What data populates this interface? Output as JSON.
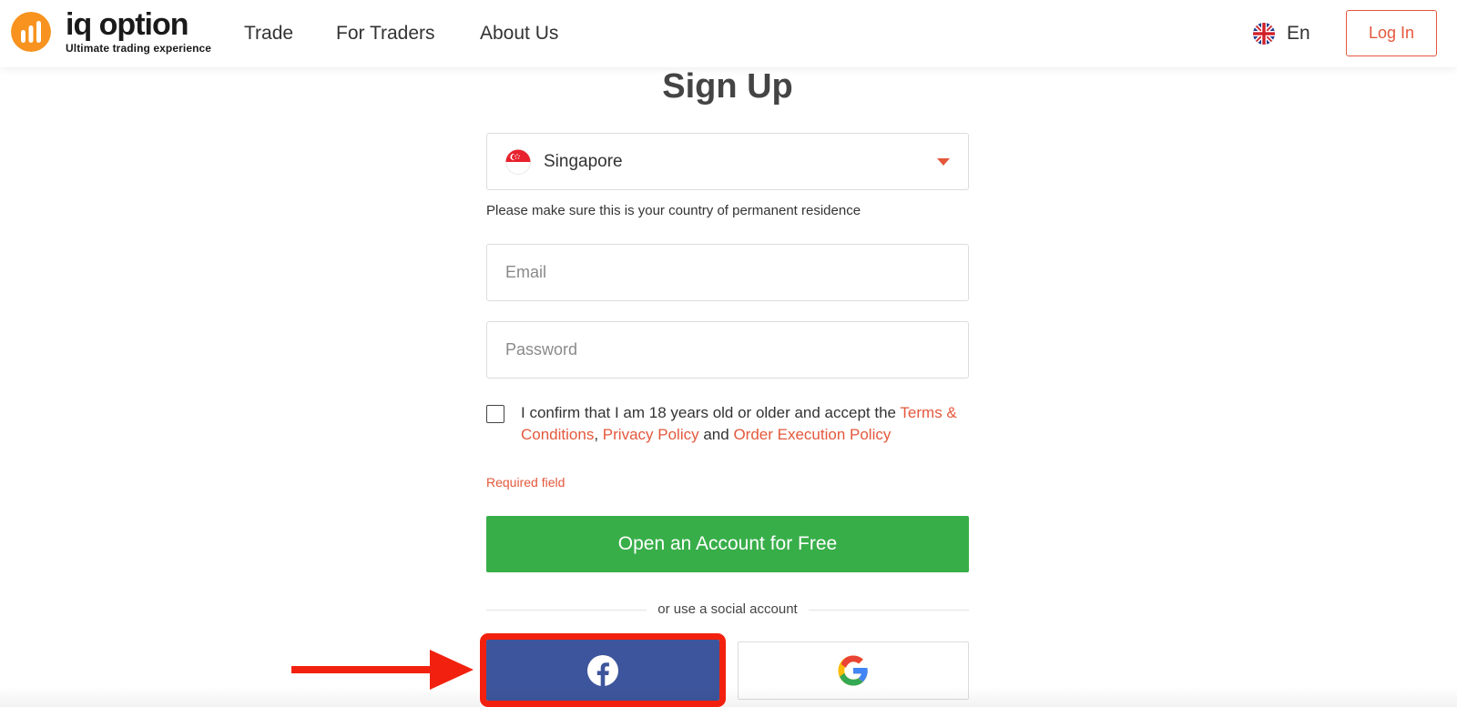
{
  "header": {
    "logo": {
      "name": "iq option",
      "tagline": "Ultimate trading experience"
    },
    "nav": [
      "Trade",
      "For Traders",
      "About Us"
    ],
    "language": "En",
    "login_label": "Log In"
  },
  "signup": {
    "title": "Sign Up",
    "country": {
      "value": "Singapore",
      "hint": "Please make sure this is your country of permanent residence"
    },
    "email_placeholder": "Email",
    "password_placeholder": "Password",
    "consent": {
      "text": "I confirm that I am 18 years old or older and accept the",
      "terms": "Terms & Conditions",
      "separator": ",",
      "privacy": "Privacy Policy",
      "and": "and",
      "order": "Order Execution Policy"
    },
    "required_text": "Required field",
    "submit_label": "Open an Account for Free",
    "social_divider": "or use a social account",
    "social_buttons": [
      "facebook-icon",
      "google-icon"
    ]
  },
  "colors": {
    "accent": "#e4583c",
    "submit": "#38ae49",
    "facebook": "#3d559c",
    "highlight": "#f2210f"
  }
}
